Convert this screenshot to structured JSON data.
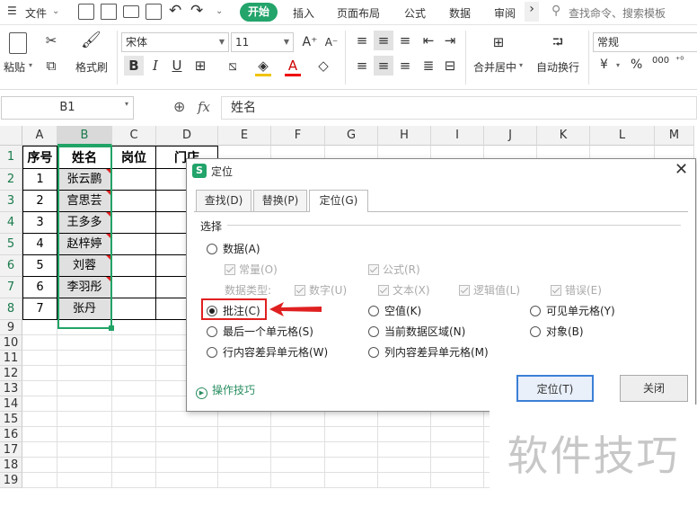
{
  "menubar": {
    "file": "文件",
    "tabs": [
      "开始",
      "插入",
      "页面布局",
      "公式",
      "数据",
      "审阅"
    ],
    "more": "›",
    "search_placeholder": "查找命令、搜索模板"
  },
  "ribbon": {
    "paste": "粘贴",
    "format_painter": "格式刷",
    "font_name": "宋体",
    "font_size": "11",
    "merge_center": "合并居中",
    "wrap_text": "自动换行",
    "number_format": "常规",
    "yuan": "¥",
    "percent": "%",
    "thousands": "000"
  },
  "formula_bar": {
    "name_box": "B1",
    "fx": "fx",
    "content": "姓名"
  },
  "sheet": {
    "columns": [
      "A",
      "B",
      "C",
      "D",
      "E",
      "F",
      "G",
      "H",
      "I",
      "J",
      "K",
      "L",
      "M"
    ],
    "rows": [
      "1",
      "2",
      "3",
      "4",
      "5",
      "6",
      "7",
      "8",
      "9",
      "10",
      "11",
      "12",
      "13",
      "14",
      "15",
      "16",
      "17",
      "18",
      "19"
    ],
    "headers": [
      "序号",
      "姓名",
      "岗位",
      "门店"
    ],
    "data": [
      {
        "no": "1",
        "name": "张云鹏"
      },
      {
        "no": "2",
        "name": "宫思芸"
      },
      {
        "no": "3",
        "name": "王多多"
      },
      {
        "no": "4",
        "name": "赵梓婷"
      },
      {
        "no": "5",
        "name": "刘蓉"
      },
      {
        "no": "6",
        "name": "李羽彤"
      },
      {
        "no": "7",
        "name": "张丹"
      }
    ]
  },
  "dialog": {
    "title": "定位",
    "tabs": [
      "查找(D)",
      "替换(P)",
      "定位(G)"
    ],
    "section": "选择",
    "options": {
      "data": "数据(A)",
      "constant": "常量(O)",
      "formula": "公式(R)",
      "data_type": "数据类型:",
      "number": "数字(U)",
      "text": "文本(X)",
      "logical": "逻辑值(L)",
      "error": "错误(E)",
      "comment": "批注(C)",
      "blank": "空值(K)",
      "visible": "可见单元格(Y)",
      "last_cell": "最后一个单元格(S)",
      "current_region": "当前数据区域(N)",
      "object": "对象(B)",
      "row_diff": "行内容差异单元格(W)",
      "col_diff": "列内容差异单元格(M)"
    },
    "tips": "操作技巧",
    "ok": "定位(T)",
    "close": "关闭"
  },
  "watermark": "软件技巧",
  "colors": {
    "accent": "#22a46b",
    "selection_border": "#21a366",
    "annotation_red": "#e02020",
    "ok_border": "#3c7fd6"
  }
}
